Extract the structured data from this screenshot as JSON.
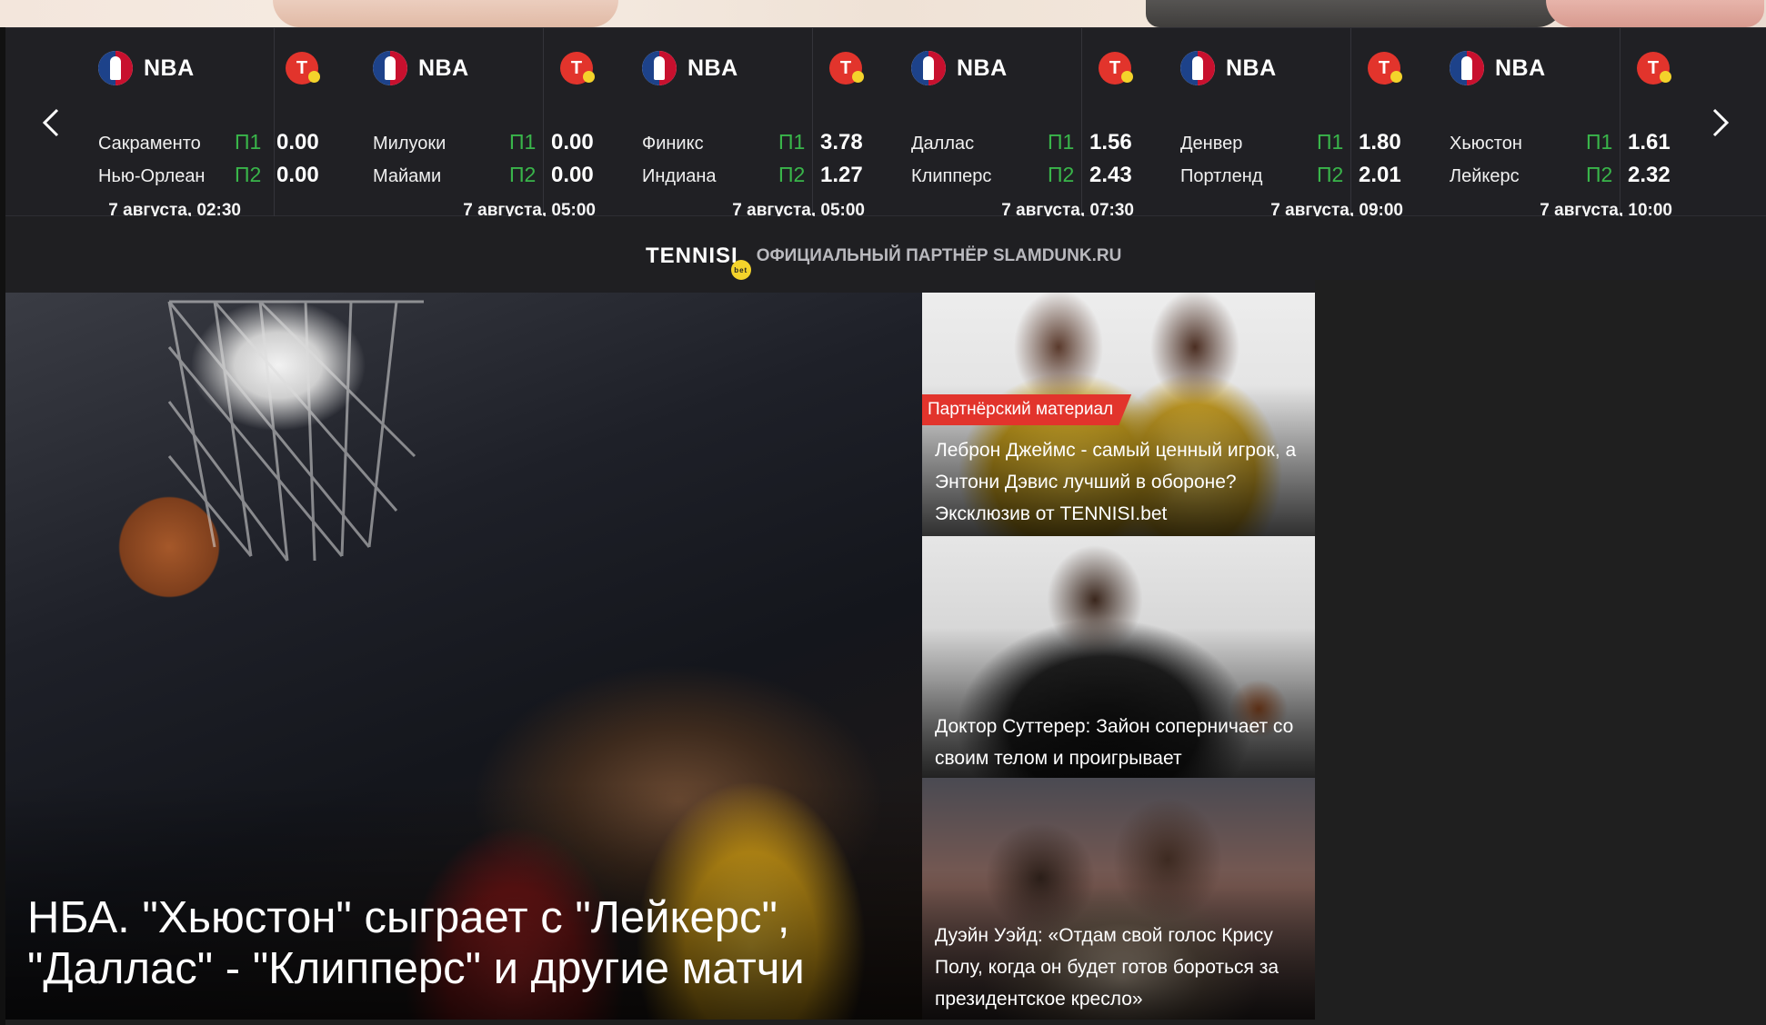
{
  "odds_bar": {
    "matches": [
      {
        "league": "NBA",
        "bookmaker_logo": "T",
        "team1": "Сакраменто",
        "team2": "Нью-Орлеан",
        "p1_label": "П1",
        "p1": "0.00",
        "p2_label": "П2",
        "p2": "0.00",
        "time": "7 августа, 02:30"
      },
      {
        "league": "NBA",
        "bookmaker_logo": "T",
        "team1": "Милуоки",
        "team2": "Майами",
        "p1_label": "П1",
        "p1": "0.00",
        "p2_label": "П2",
        "p2": "0.00",
        "time": "7 августа, 05:00"
      },
      {
        "league": "NBA",
        "bookmaker_logo": "T",
        "team1": "Финикс",
        "team2": "Индиана",
        "p1_label": "П1",
        "p1": "3.78",
        "p2_label": "П2",
        "p2": "1.27",
        "time": "7 августа, 05:00"
      },
      {
        "league": "NBA",
        "bookmaker_logo": "T",
        "team1": "Даллас",
        "team2": "Клипперс",
        "p1_label": "П1",
        "p1": "1.56",
        "p2_label": "П2",
        "p2": "2.43",
        "time": "7 августа, 07:30"
      },
      {
        "league": "NBA",
        "bookmaker_logo": "T",
        "team1": "Денвер",
        "team2": "Портленд",
        "p1_label": "П1",
        "p1": "1.80",
        "p2_label": "П2",
        "p2": "2.01",
        "time": "7 августа, 09:00"
      },
      {
        "league": "NBA",
        "bookmaker_logo": "T",
        "team1": "Хьюстон",
        "team2": "Лейкерс",
        "p1_label": "П1",
        "p1": "1.61",
        "p2_label": "П2",
        "p2": "2.32",
        "time": "7 августа, 10:00"
      }
    ],
    "icons": {
      "prev": "chevron-left-icon",
      "next": "chevron-right-icon"
    },
    "colors": {
      "odd_label": "#39b54a",
      "bookmaker": "#e2342c"
    }
  },
  "partner": {
    "logo_text": "TENNISI",
    "logo_badge": "bet",
    "text": "ОФИЦИАЛЬНЫЙ ПАРТНЁР SLAMDUNK.RU"
  },
  "hero": {
    "title": "НБА. \"Хьюстон\" сыграет с \"Лейкерс\", \"Даллас\" - \"Клипперс\" и другие матчи"
  },
  "side_cards": [
    {
      "tag": "Партнёрский материал",
      "title": "Леброн Джеймс - самый ценный игрок, а Энтони Дэвис лучший в обороне? Эксклюзив от TENNISI.bet"
    },
    {
      "title": "Доктор Суттерер: Зайон соперничает со своим телом и проигрывает"
    },
    {
      "title": "Дуэйн Уэйд: «Отдам свой голос Крису Полу, когда он будет готов бороться за президентское кресло»"
    }
  ]
}
